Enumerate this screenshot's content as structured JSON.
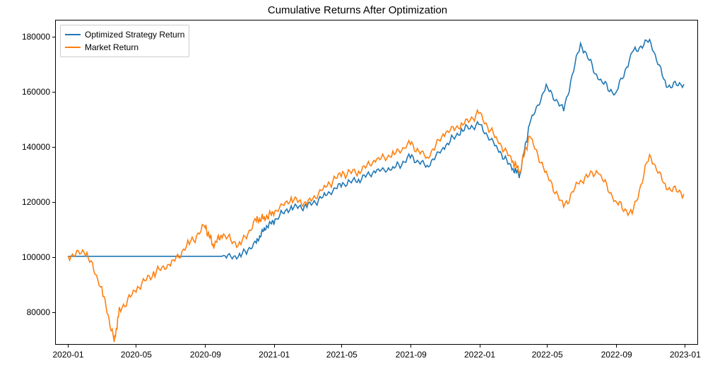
{
  "chart_data": {
    "type": "line",
    "title": "Cumulative Returns After Optimization",
    "xlabel": "",
    "ylabel": "",
    "x_ticks": [
      "2020-01",
      "2020-05",
      "2020-09",
      "2021-01",
      "2021-05",
      "2021-09",
      "2022-01",
      "2022-05",
      "2022-09",
      "2023-01"
    ],
    "y_ticks": [
      80000,
      100000,
      120000,
      140000,
      160000,
      180000
    ],
    "ylim": [
      68000,
      186000
    ],
    "legend_position": "upper left",
    "x": [
      "2020-01-01",
      "2020-02-01",
      "2020-03-01",
      "2020-03-23",
      "2020-04-01",
      "2020-05-01",
      "2020-06-01",
      "2020-07-01",
      "2020-08-01",
      "2020-09-01",
      "2020-09-15",
      "2020-10-01",
      "2020-11-01",
      "2020-12-01",
      "2020-12-15",
      "2021-01-01",
      "2021-02-01",
      "2021-03-01",
      "2021-04-01",
      "2021-05-01",
      "2021-06-01",
      "2021-07-01",
      "2021-08-01",
      "2021-09-01",
      "2021-10-01",
      "2021-11-01",
      "2021-12-01",
      "2022-01-01",
      "2022-02-01",
      "2022-03-01",
      "2022-03-15",
      "2022-04-01",
      "2022-05-01",
      "2022-06-01",
      "2022-07-01",
      "2022-08-01",
      "2022-09-01",
      "2022-10-01",
      "2022-11-01",
      "2022-12-01",
      "2023-01-01"
    ],
    "series": [
      {
        "name": "Optimized Strategy Return",
        "color": "#1f77b4",
        "values": [
          100000,
          100000,
          100000,
          100000,
          100000,
          100000,
          100000,
          100000,
          100000,
          100000,
          100000,
          100000,
          100000,
          105000,
          110000,
          113000,
          118000,
          118000,
          122000,
          126000,
          128000,
          131000,
          132000,
          136000,
          133000,
          140000,
          146000,
          148000,
          140000,
          132000,
          130000,
          148000,
          162000,
          153000,
          178000,
          165000,
          159000,
          174000,
          179000,
          162000,
          163000
        ]
      },
      {
        "name": "Market Return",
        "color": "#ff7f0e",
        "values": [
          100000,
          102000,
          88000,
          69000,
          80000,
          88000,
          94000,
          97000,
          104000,
          111000,
          104000,
          108000,
          104000,
          113000,
          114000,
          116000,
          121000,
          119000,
          125000,
          130000,
          131000,
          135000,
          137000,
          141000,
          136000,
          145000,
          148000,
          152000,
          143000,
          135000,
          131000,
          144000,
          130000,
          118000,
          128000,
          131000,
          120000,
          115000,
          137000,
          125000,
          123000
        ]
      }
    ]
  }
}
